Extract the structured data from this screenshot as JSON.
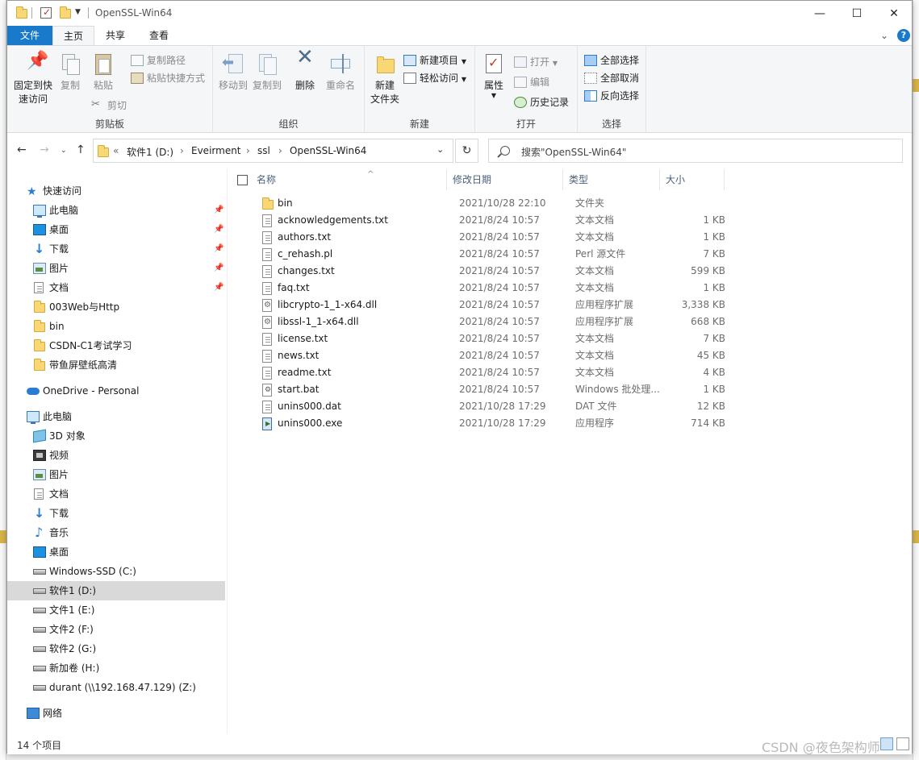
{
  "window": {
    "title": "OpenSSL-Win64"
  },
  "tabs": {
    "file": "文件",
    "home": "主页",
    "share": "共享",
    "view": "查看"
  },
  "ribbon": {
    "clipboard": {
      "label": "剪贴板",
      "pin_quick": "固定到快\n速访问",
      "copy": "复制",
      "paste": "粘贴",
      "copy_path": "复制路径",
      "paste_shortcut": "粘贴快捷方式",
      "cut": "剪切"
    },
    "organize": {
      "label": "组织",
      "move_to": "移动到",
      "copy_to": "复制到",
      "delete": "删除",
      "rename": "重命名"
    },
    "new": {
      "label": "新建",
      "new_folder": "新建\n文件夹",
      "new_item": "新建项目",
      "easy_access": "轻松访问"
    },
    "open": {
      "label": "打开",
      "properties": "属性",
      "open": "打开",
      "edit": "编辑",
      "history": "历史记录"
    },
    "select": {
      "label": "选择",
      "select_all": "全部选择",
      "select_none": "全部取消",
      "invert": "反向选择"
    }
  },
  "address": {
    "overflow": "«",
    "crumbs": [
      "软件1 (D:)",
      "Eveirment",
      "ssl",
      "OpenSSL-Win64"
    ],
    "search_placeholder": "搜索\"OpenSSL-Win64\""
  },
  "nav": {
    "quick_access": "快速访问",
    "quick": [
      "此电脑",
      "桌面",
      "下载",
      "图片",
      "文档",
      "003Web与Http",
      "bin",
      "CSDN-C1考试学习",
      "带鱼屏壁纸高清"
    ],
    "onedrive": "OneDrive - Personal",
    "this_pc": "此电脑",
    "pc_items": [
      "3D 对象",
      "视频",
      "图片",
      "文档",
      "下载",
      "音乐",
      "桌面",
      "Windows-SSD (C:)",
      "软件1 (D:)",
      "文件1 (E:)",
      "文件2 (F:)",
      "软件2 (G:)",
      "新加卷 (H:)",
      "durant (\\\\192.168.47.129) (Z:)"
    ],
    "network": "网络"
  },
  "columns": {
    "name": "名称",
    "date": "修改日期",
    "type": "类型",
    "size": "大小"
  },
  "files": [
    {
      "name": "bin",
      "date": "2021/10/28 22:10",
      "type": "文件夹",
      "size": "",
      "icon": "folder-icon"
    },
    {
      "name": "acknowledgements.txt",
      "date": "2021/8/24 10:57",
      "type": "文本文档",
      "size": "1 KB",
      "icon": "text-file-icon"
    },
    {
      "name": "authors.txt",
      "date": "2021/8/24 10:57",
      "type": "文本文档",
      "size": "1 KB",
      "icon": "text-file-icon"
    },
    {
      "name": "c_rehash.pl",
      "date": "2021/8/24 10:57",
      "type": "Perl 源文件",
      "size": "7 KB",
      "icon": "text-file-icon"
    },
    {
      "name": "changes.txt",
      "date": "2021/8/24 10:57",
      "type": "文本文档",
      "size": "599 KB",
      "icon": "text-file-icon"
    },
    {
      "name": "faq.txt",
      "date": "2021/8/24 10:57",
      "type": "文本文档",
      "size": "1 KB",
      "icon": "text-file-icon"
    },
    {
      "name": "libcrypto-1_1-x64.dll",
      "date": "2021/8/24 10:57",
      "type": "应用程序扩展",
      "size": "3,338 KB",
      "icon": "dll-file-icon"
    },
    {
      "name": "libssl-1_1-x64.dll",
      "date": "2021/8/24 10:57",
      "type": "应用程序扩展",
      "size": "668 KB",
      "icon": "dll-file-icon"
    },
    {
      "name": "license.txt",
      "date": "2021/8/24 10:57",
      "type": "文本文档",
      "size": "7 KB",
      "icon": "text-file-icon"
    },
    {
      "name": "news.txt",
      "date": "2021/8/24 10:57",
      "type": "文本文档",
      "size": "45 KB",
      "icon": "text-file-icon"
    },
    {
      "name": "readme.txt",
      "date": "2021/8/24 10:57",
      "type": "文本文档",
      "size": "4 KB",
      "icon": "text-file-icon"
    },
    {
      "name": "start.bat",
      "date": "2021/8/24 10:57",
      "type": "Windows 批处理...",
      "size": "1 KB",
      "icon": "bat-file-icon"
    },
    {
      "name": "unins000.dat",
      "date": "2021/10/28 17:29",
      "type": "DAT 文件",
      "size": "12 KB",
      "icon": "text-file-icon"
    },
    {
      "name": "unins000.exe",
      "date": "2021/10/28 17:29",
      "type": "应用程序",
      "size": "714 KB",
      "icon": "exe-file-icon"
    }
  ],
  "status": {
    "count": "14 个项目"
  },
  "watermark": "CSDN @夜色架构师",
  "colors": {
    "accent": "#1979ca",
    "folder": "#f8d775",
    "selection": "#d9d9d9"
  }
}
